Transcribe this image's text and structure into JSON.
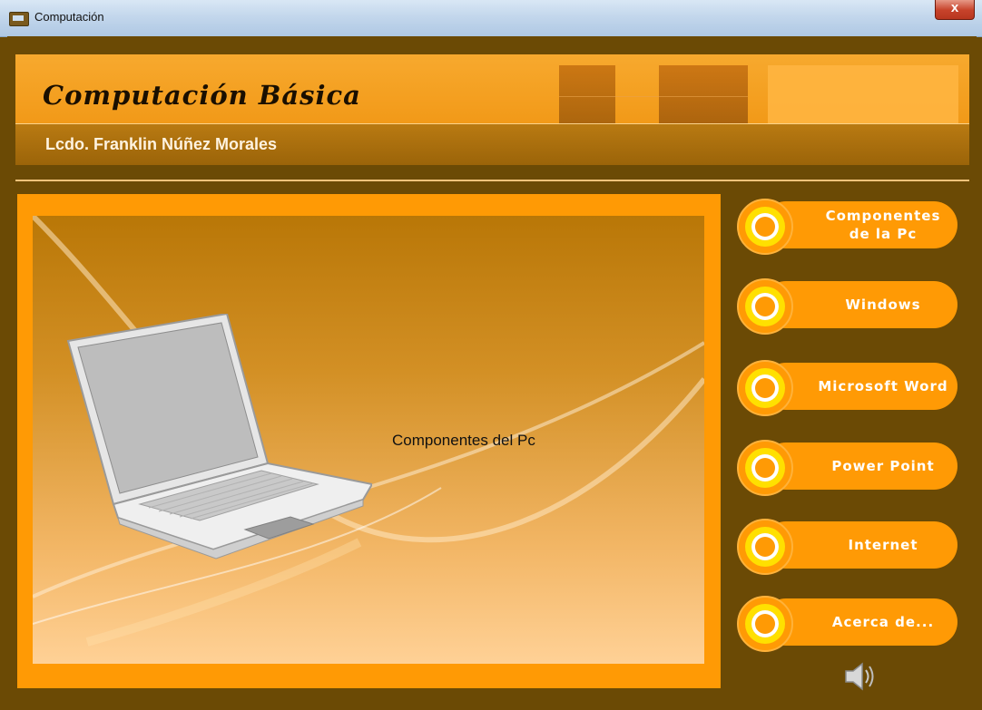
{
  "window": {
    "title": "Computación",
    "close_glyph": "x"
  },
  "header": {
    "title": "Computación Básica",
    "author": "Lcdo. Franklin Núñez Morales"
  },
  "main": {
    "caption": "Componentes del Pc",
    "image": "laptop-illustration"
  },
  "nav": {
    "items": [
      {
        "label": "Componentes de la Pc"
      },
      {
        "label": "Windows"
      },
      {
        "label": "Microsoft Word"
      },
      {
        "label": "Power Point"
      },
      {
        "label": "Internet"
      },
      {
        "label": "Acerca de..."
      }
    ]
  },
  "icons": {
    "window": "app-icon",
    "sound": "speaker-icon"
  },
  "colors": {
    "frame": "#6b4a05",
    "accent": "#ff9a05",
    "ring": "#ffe000"
  }
}
